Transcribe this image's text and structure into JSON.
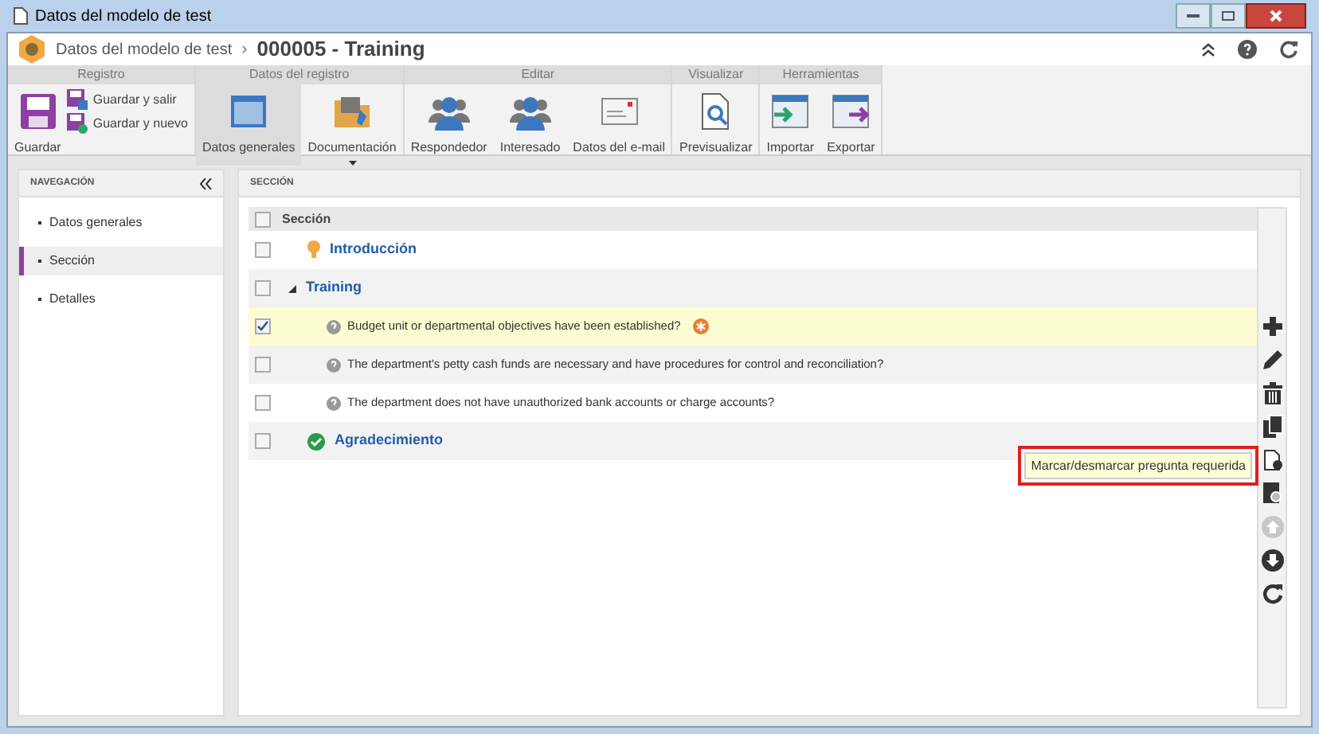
{
  "window": {
    "title": "Datos del modelo de test"
  },
  "breadcrumb": {
    "parent": "Datos del modelo de test",
    "separator": "›",
    "current": "000005 - Training"
  },
  "ribbon": [
    {
      "label": "Registro",
      "items": [
        {
          "kind": "save",
          "label": "Guardar",
          "selected": false
        },
        {
          "kind": "small",
          "label": "Guardar y salir",
          "selected": false
        },
        {
          "kind": "small2",
          "label": "Guardar y nuevo",
          "selected": false
        }
      ]
    },
    {
      "label": "Datos del registro",
      "items": [
        {
          "kind": "window",
          "label": "Datos generales",
          "selected": true
        },
        {
          "kind": "folder",
          "label": "Documentación",
          "selected": false,
          "dropdown": true
        }
      ]
    },
    {
      "label": "Editar",
      "items": [
        {
          "kind": "users",
          "label": "Respondedor",
          "selected": false
        },
        {
          "kind": "users",
          "label": "Interesado",
          "selected": false
        },
        {
          "kind": "mail",
          "label": "Datos del e-mail",
          "selected": false
        }
      ]
    },
    {
      "label": "Visualizar",
      "items": [
        {
          "kind": "preview",
          "label": "Previsualizar",
          "selected": false
        }
      ]
    },
    {
      "label": "Herramientas",
      "items": [
        {
          "kind": "import",
          "label": "Importar",
          "selected": false
        },
        {
          "kind": "export",
          "label": "Exportar",
          "selected": false
        }
      ]
    }
  ],
  "navigation": {
    "title": "NAVEGACIÓN",
    "items": [
      {
        "label": "Datos generales",
        "selected": false
      },
      {
        "label": "Sección",
        "selected": true
      },
      {
        "label": "Detalles",
        "selected": false
      }
    ]
  },
  "section": {
    "title": "SECCIÓN",
    "column": "Sección",
    "header_checked": false,
    "rows": [
      {
        "kind": "intro",
        "label": "Introducción",
        "checked": false,
        "selected": false
      },
      {
        "kind": "group",
        "label": "Training",
        "checked": false,
        "selected": false,
        "expanded": true
      },
      {
        "kind": "question",
        "label": "Budget unit or departmental objectives have been established?",
        "checked": true,
        "selected": true,
        "required": true
      },
      {
        "kind": "question",
        "label": "The department's petty cash funds are necessary and have procedures for control and reconciliation?",
        "checked": false,
        "selected": false,
        "required": false
      },
      {
        "kind": "question",
        "label": "The department does not have unauthorized bank accounts or charge accounts?",
        "checked": false,
        "selected": false,
        "required": false
      },
      {
        "kind": "closing",
        "label": "Agradecimiento",
        "checked": false,
        "selected": false
      }
    ]
  },
  "toolbar": [
    {
      "kind": "add",
      "disabled": false
    },
    {
      "kind": "edit",
      "disabled": false
    },
    {
      "kind": "delete",
      "disabled": false
    },
    {
      "kind": "copy",
      "disabled": false
    },
    {
      "kind": "required",
      "disabled": false
    },
    {
      "kind": "view",
      "disabled": false
    },
    {
      "kind": "up",
      "disabled": true
    },
    {
      "kind": "down",
      "disabled": false
    },
    {
      "kind": "refresh",
      "disabled": false
    }
  ],
  "tooltip": {
    "text": "Marcar/desmarcar pregunta requerida"
  }
}
